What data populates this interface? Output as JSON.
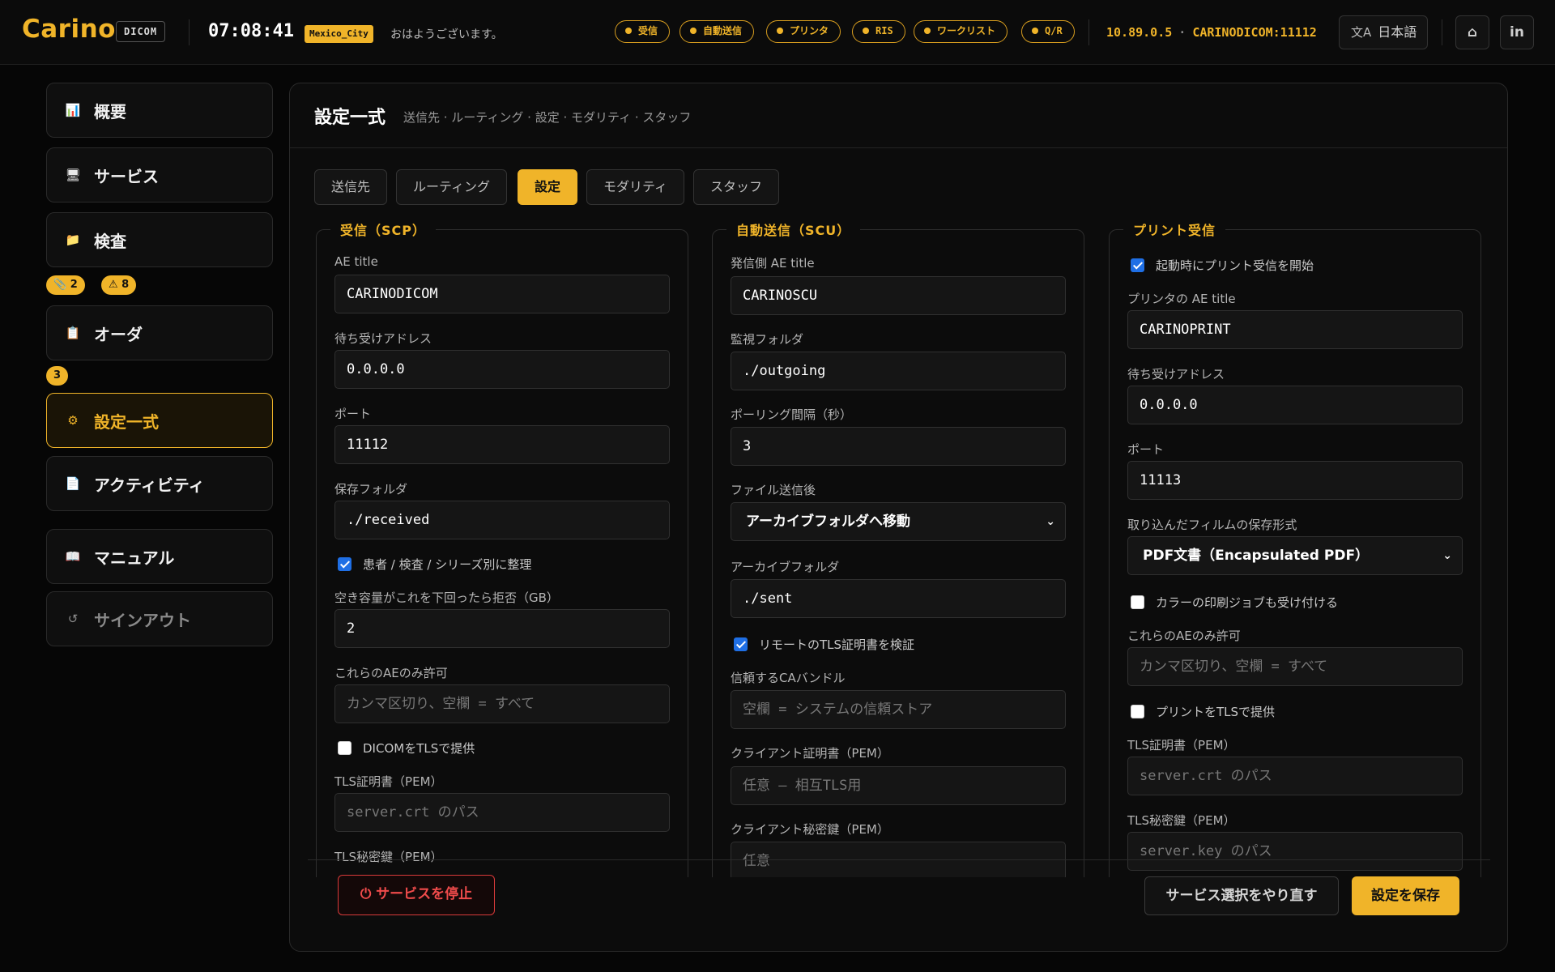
{
  "brand": {
    "name": "Carino",
    "tag": "DICOM"
  },
  "header": {
    "clock": "07:08:41",
    "timezone": "Mexico_City",
    "greeting": "おはようございます。",
    "statuses": [
      "受信",
      "自動送信",
      "プリンタ",
      "RIS",
      "ワークリスト",
      "Q/R"
    ],
    "ip": "10.89.0.5",
    "separator": "·",
    "endpoint": "CARINODICOM:11112",
    "language": "日本語",
    "language_icon": "translate-icon",
    "github_icon": "github-icon",
    "linkedin_icon": "linkedin-icon",
    "github_glyph": "⌂",
    "linkedin_glyph": "in"
  },
  "sidebar": {
    "items": [
      {
        "label": "概要",
        "icon": "chart-icon",
        "glyph": "📊"
      },
      {
        "label": "サービス",
        "icon": "monitor-icon",
        "glyph": "🖥"
      },
      {
        "label": "検査",
        "icon": "folder-icon",
        "glyph": "📁"
      },
      {
        "label": "オーダ",
        "icon": "clipboard-icon",
        "glyph": "📋"
      },
      {
        "label": "設定一式",
        "icon": "gear-icon",
        "glyph": "⚙"
      },
      {
        "label": "アクティビティ",
        "icon": "document-icon",
        "glyph": "📄"
      },
      {
        "label": "マニュアル",
        "icon": "book-icon",
        "glyph": "📖"
      },
      {
        "label": "サインアウト",
        "icon": "signout-icon",
        "glyph": "↺"
      }
    ],
    "badges": {
      "exam_clip": "📎 2",
      "exam_warn": "⚠ 8",
      "orders": "3"
    }
  },
  "panel": {
    "title": "設定一式",
    "subtitle": "送信先 · ルーティング · 設定 · モダリティ · スタッフ",
    "tabs": [
      "送信先",
      "ルーティング",
      "設定",
      "モダリティ",
      "スタッフ"
    ],
    "active_tab": "設定"
  },
  "scp": {
    "legend": "受信（SCP）",
    "ae_title_label": "AE title",
    "ae_title": "CARINODICOM",
    "listen_label": "待ち受けアドレス",
    "listen": "0.0.0.0",
    "port_label": "ポート",
    "port": "11112",
    "folder_label": "保存フォルダ",
    "folder": "./received",
    "organize_label": "患者 / 検査 / シリーズ別に整理",
    "organize": true,
    "min_free_label": "空き容量がこれを下回ったら拒否（GB）",
    "min_free": "2",
    "allow_label": "これらのAEのみ許可",
    "allow_placeholder": "カンマ区切り、空欄 = すべて",
    "tls_label": "DICOMをTLSで提供",
    "tls": false,
    "cert_label": "TLS証明書（PEM）",
    "cert_placeholder": "server.crt のパス",
    "key_label": "TLS秘密鍵（PEM）"
  },
  "scu": {
    "legend": "自動送信（SCU）",
    "ae_title_label": "発信側 AE title",
    "ae_title": "CARINOSCU",
    "watch_label": "監視フォルダ",
    "watch": "./outgoing",
    "poll_label": "ポーリング間隔（秒）",
    "poll": "3",
    "after_label": "ファイル送信後",
    "after": "アーカイブフォルダへ移動",
    "archive_label": "アーカイブフォルダ",
    "archive": "./sent",
    "verify_label": "リモートのTLS証明書を検証",
    "verify": true,
    "ca_label": "信頼するCAバンドル",
    "ca_placeholder": "空欄 = システムの信頼ストア",
    "client_cert_label": "クライアント証明書（PEM）",
    "client_cert_placeholder": "任意 — 相互TLS用",
    "client_key_label": "クライアント秘密鍵（PEM）",
    "client_key_placeholder": "任意"
  },
  "print": {
    "legend": "プリント受信",
    "autostart_label": "起動時にプリント受信を開始",
    "autostart": true,
    "ae_title_label": "プリンタの AE title",
    "ae_title": "CARINOPRINT",
    "listen_label": "待ち受けアドレス",
    "listen": "0.0.0.0",
    "port_label": "ポート",
    "port": "11113",
    "format_label": "取り込んだフィルムの保存形式",
    "format": "PDF文書（Encapsulated PDF）",
    "color_label": "カラーの印刷ジョブも受け付ける",
    "color": false,
    "allow_label": "これらのAEのみ許可",
    "allow_placeholder": "カンマ区切り、空欄 = すべて",
    "tls_label": "プリントをTLSで提供",
    "tls": false,
    "cert_label": "TLS証明書（PEM）",
    "cert_placeholder": "server.crt のパス",
    "key_label": "TLS秘密鍵（PEM）",
    "key_placeholder": "server.key のパス"
  },
  "actions": {
    "stop": "⏻ サービスを停止",
    "reset": "サービス選択をやり直す",
    "save": "設定を保存"
  },
  "colors": {
    "accent": "#f0b429",
    "danger": "#ef4b4b",
    "check": "#1f6fe5"
  }
}
